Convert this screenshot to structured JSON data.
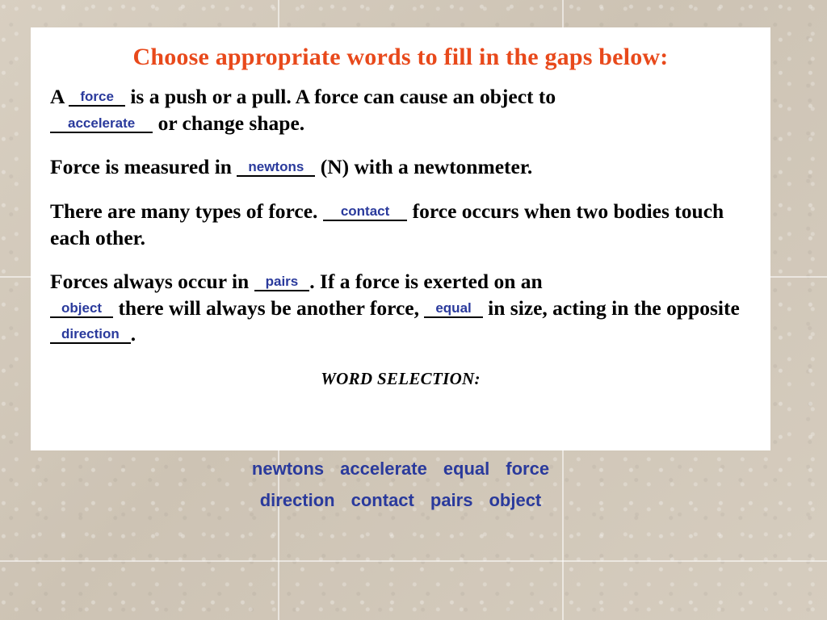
{
  "slide": {
    "title": "Choose appropriate words to fill in the gaps below:",
    "title_color": "#e8491b",
    "answer_color": "#2a3a9c",
    "card_color": "#ffffff",
    "background_color": "#d3cabc"
  },
  "paragraphs": {
    "p1": {
      "t1": "A",
      "blank1": "force",
      "t2": "is a push or a pull. A force can cause an object to",
      "blank2": "accelerate",
      "t3": "or change shape."
    },
    "p2": {
      "t1": "Force is measured in",
      "blank1": "newtons",
      "t2": "(N) with a newtonmeter."
    },
    "p3": {
      "t1": "There are many types of force.",
      "blank1": "contact",
      "t2": "force occurs when two bodies touch each other."
    },
    "p4": {
      "t1": "Forces always occur in",
      "blank1": "pairs",
      "t2": ". If a force is exerted on an",
      "blank2": "object",
      "t3": "there will always be another force,",
      "blank3": "equal",
      "t4": "in size, acting in the opposite",
      "blank4": "direction",
      "t5": "."
    }
  },
  "word_selection": {
    "heading": "WORD SELECTION:",
    "row1": [
      "newtons",
      "accelerate",
      "equal",
      "force"
    ],
    "row2": [
      "direction",
      "contact",
      "pairs",
      "object"
    ]
  }
}
